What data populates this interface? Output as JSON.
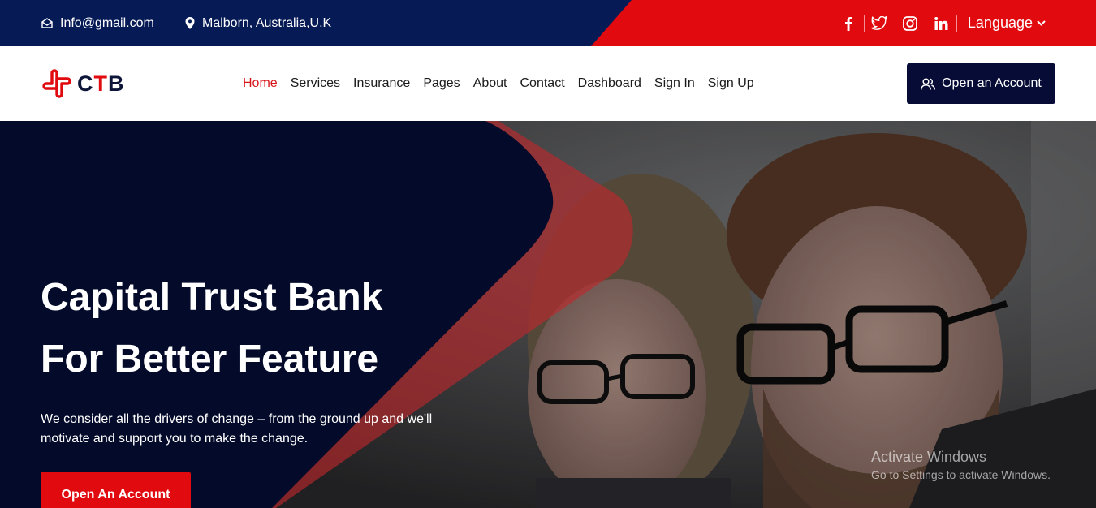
{
  "topbar": {
    "email": "Info@gmail.com",
    "location": "Malborn, Australia,U.K",
    "language": "Language",
    "social_icons": [
      "facebook-icon",
      "twitter-icon",
      "instagram-icon",
      "linkedin-icon"
    ]
  },
  "brand": {
    "logo_prefix": "C",
    "logo_accent": "T",
    "logo_suffix": "B"
  },
  "nav": {
    "items": [
      "Home",
      "Services",
      "Insurance",
      "Pages",
      "About",
      "Contact",
      "Dashboard",
      "Sign In",
      "Sign Up"
    ],
    "active": "Home"
  },
  "header": {
    "cta": "Open an Account"
  },
  "hero": {
    "title_line1": "Capital Trust Bank",
    "title_line2": "For Better Feature",
    "subtitle": "We consider all the drivers of change – from the ground up and we'll motivate and support you to make the change.",
    "cta": "Open An Account"
  },
  "watermark": {
    "line1": "Activate Windows",
    "line2": "Go to Settings to activate Windows."
  },
  "colors": {
    "navy": "#061a55",
    "dark_navy": "#060c36",
    "red": "#e00a0f",
    "active_link": "#d81418"
  }
}
